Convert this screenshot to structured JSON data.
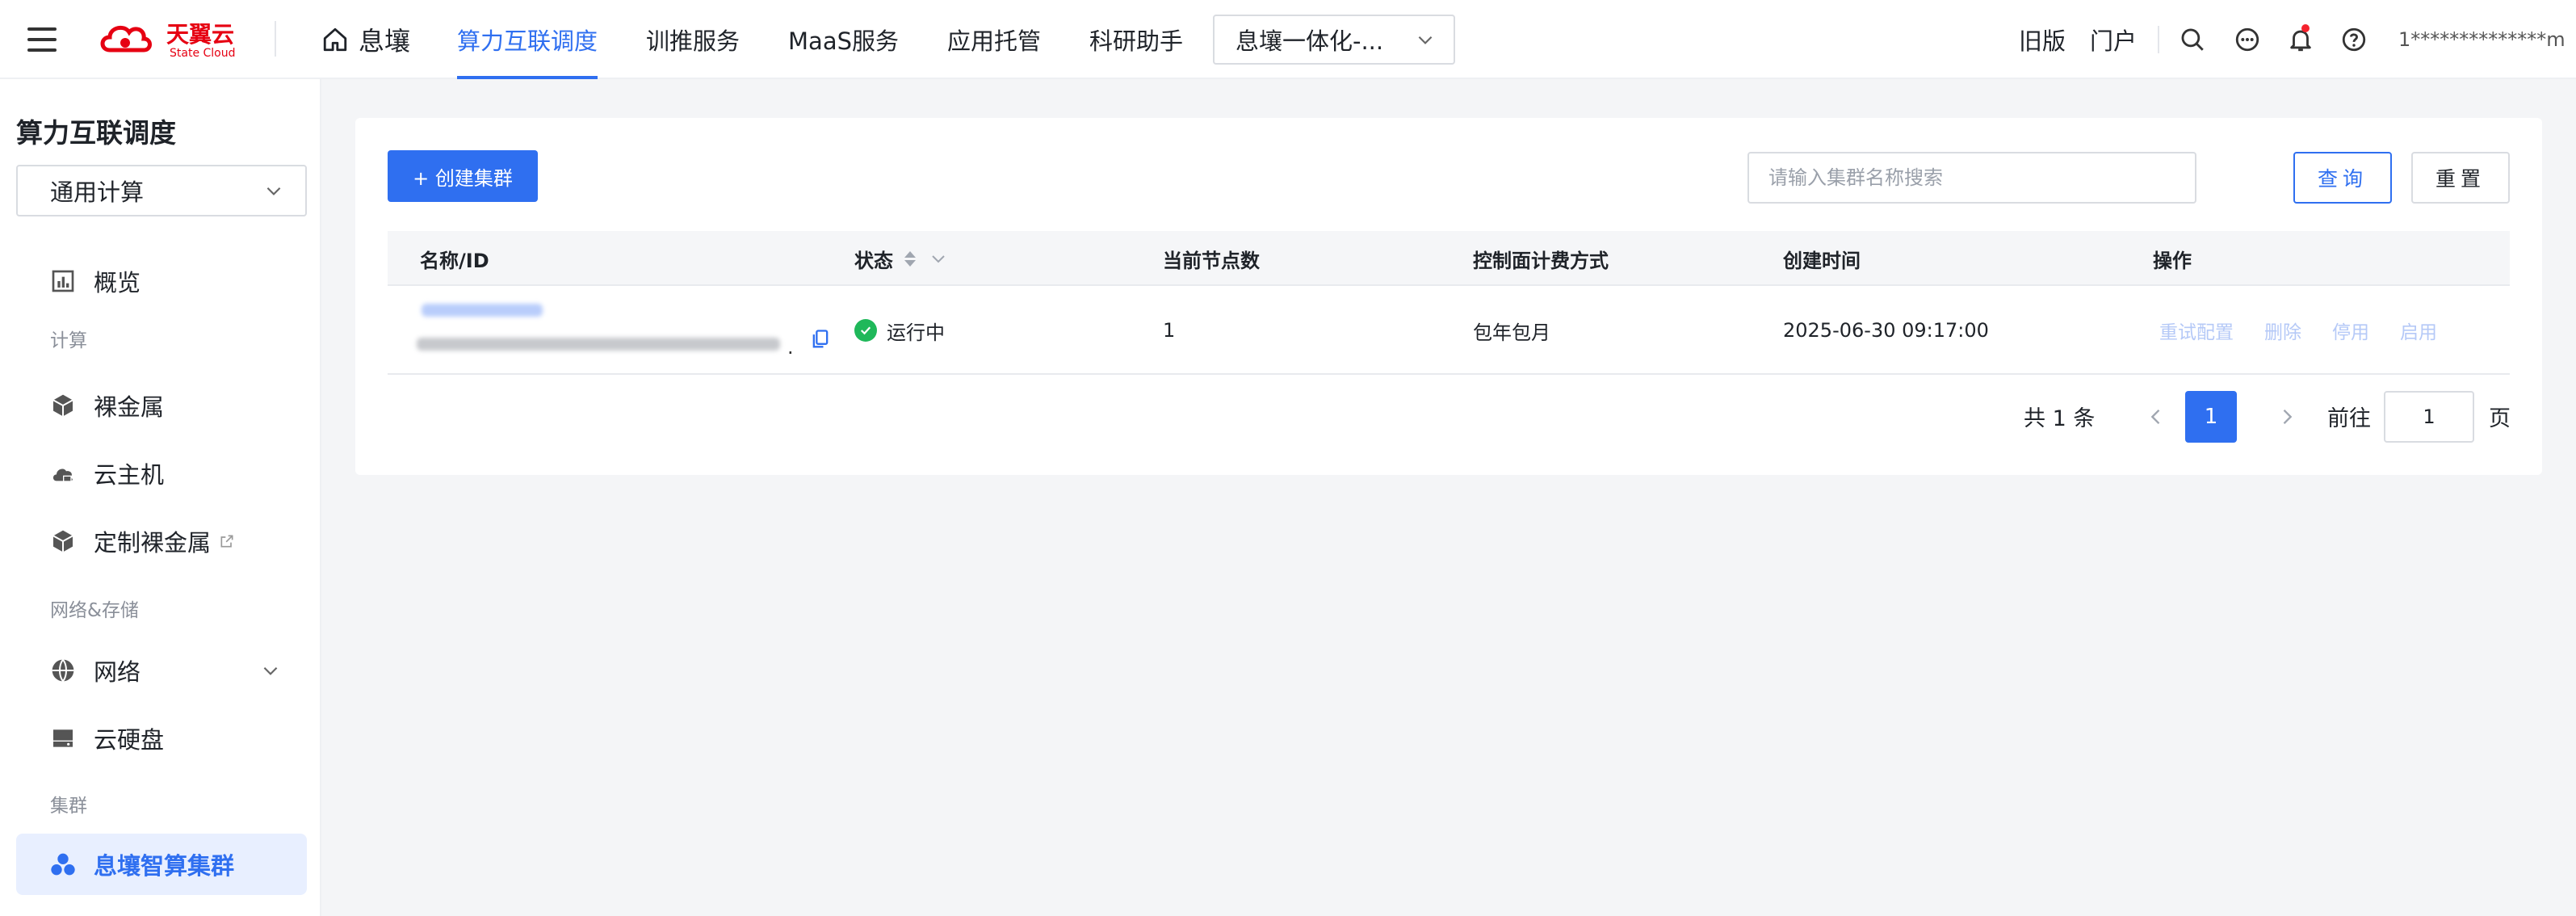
{
  "header": {
    "logo_text": "天翼云",
    "logo_sub": "State Cloud",
    "home_label": "息壤",
    "nav": [
      {
        "label": "算力互联调度",
        "active": true
      },
      {
        "label": "训推服务",
        "active": false
      },
      {
        "label": "MaaS服务",
        "active": false
      },
      {
        "label": "应用托管",
        "active": false
      },
      {
        "label": "科研助手",
        "active": false
      }
    ],
    "project_select": "息壤一体化-...",
    "old_version": "旧版",
    "portal": "门户",
    "user": "1**************m"
  },
  "sidebar": {
    "title": "算力互联调度",
    "select_value": "通用计算",
    "items": {
      "overview": "概览",
      "group_compute": "计算",
      "bare_metal": "裸金属",
      "cloud_host": "云主机",
      "custom_bare_metal": "定制裸金属",
      "group_network_storage": "网络&存储",
      "network": "网络",
      "cloud_disk": "云硬盘",
      "group_cluster": "集群",
      "smart_cluster": "息壤智算集群"
    }
  },
  "main": {
    "create_button": "+ 创建集群",
    "search_placeholder": "请输入集群名称搜索",
    "query_button": "查询",
    "reset_button": "重置",
    "columns": {
      "name": "名称/ID",
      "status": "状态",
      "nodes": "当前节点数",
      "billing": "控制面计费方式",
      "created": "创建时间",
      "ops": "操作"
    },
    "rows": [
      {
        "status": "运行中",
        "nodes": "1",
        "billing": "包年包月",
        "created": "2025-06-30 09:17:00",
        "ops": [
          "重试配置",
          "删除",
          "停用",
          "启用"
        ]
      }
    ],
    "pagination": {
      "total": "共 1 条",
      "current": "1",
      "goto_label": "前往",
      "goto_value": "1",
      "page_label": "页"
    }
  },
  "colors": {
    "accent": "#2f6ff0",
    "success": "#1fb85a",
    "logo_red": "#e60012",
    "disabled_link": "#b5c9f7"
  }
}
